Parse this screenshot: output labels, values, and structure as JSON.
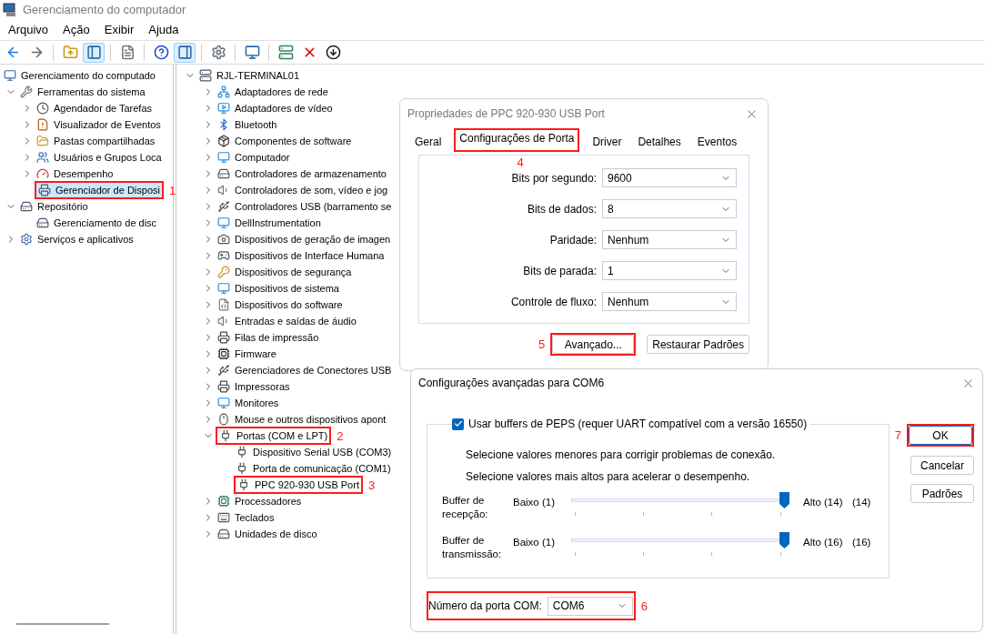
{
  "window": {
    "title": "Gerenciamento do computador"
  },
  "menu": [
    "Arquivo",
    "Ação",
    "Exibir",
    "Ajuda"
  ],
  "toolbar": {
    "groups": [
      [
        {
          "pressed": false
        },
        {
          "pressed": false
        }
      ],
      [
        {
          "pressed": false
        },
        {
          "pressed": true
        }
      ],
      [
        {
          "pressed": false
        }
      ],
      [
        {
          "pressed": false
        },
        {
          "pressed": true
        }
      ],
      [
        {
          "pressed": false
        }
      ],
      [
        {
          "pressed": false
        }
      ],
      [
        {
          "pressed": false
        },
        {
          "pressed": false
        },
        {
          "pressed": false
        }
      ]
    ]
  },
  "left_tree": {
    "label": "Gerenciamento do computado",
    "selected": false,
    "children": [
      {
        "label": "Ferramentas do sistema",
        "expanded": true,
        "selected": false,
        "children": [
          {
            "label": "Agendador de Tarefas",
            "expanded": false,
            "selected": false
          },
          {
            "label": "Visualizador de Eventos",
            "expanded": false,
            "selected": false
          },
          {
            "label": "Pastas compartilhadas",
            "expanded": false,
            "selected": false
          },
          {
            "label": "Usuários e Grupos Loca",
            "expanded": false,
            "selected": false
          },
          {
            "label": "Desempenho",
            "expanded": false,
            "selected": false
          },
          {
            "label": "Gerenciador de Disposi",
            "selected": true,
            "marker": "1"
          }
        ]
      },
      {
        "label": "Repositório",
        "expanded": true,
        "selected": false,
        "children": [
          {
            "label": "Gerenciamento de disc",
            "selected": false
          }
        ]
      },
      {
        "label": "Serviços e aplicativos",
        "expanded": false,
        "selected": false
      }
    ]
  },
  "device_tree": {
    "label": "RJL-TERMINAL01",
    "expanded": true,
    "children": [
      {
        "label": "Adaptadores de rede",
        "expanded": false
      },
      {
        "label": "Adaptadores de vídeo",
        "expanded": false
      },
      {
        "label": "Bluetooth",
        "expanded": false
      },
      {
        "label": "Componentes de software",
        "expanded": false
      },
      {
        "label": "Computador",
        "expanded": false
      },
      {
        "label": "Controladores de armazenamento",
        "expanded": false
      },
      {
        "label": "Controladores de som, vídeo e jog",
        "expanded": false
      },
      {
        "label": "Controladores USB (barramento se",
        "expanded": false
      },
      {
        "label": "DellInstrumentation",
        "expanded": false
      },
      {
        "label": "Dispositivos de geração de imagen",
        "expanded": false
      },
      {
        "label": "Dispositivos de Interface Humana",
        "expanded": false
      },
      {
        "label": "Dispositivos de segurança",
        "expanded": false
      },
      {
        "label": "Dispositivos de sistema",
        "expanded": false
      },
      {
        "label": "Dispositivos do software",
        "expanded": false
      },
      {
        "label": "Entradas e saídas de áudio",
        "expanded": false
      },
      {
        "label": "Filas de impressão",
        "expanded": false
      },
      {
        "label": "Firmware",
        "expanded": false
      },
      {
        "label": "Gerenciadores de Conectores USB",
        "expanded": false
      },
      {
        "label": "Impressoras",
        "expanded": false
      },
      {
        "label": "Monitores",
        "expanded": false
      },
      {
        "label": "Mouse e outros dispositivos apont",
        "expanded": false
      },
      {
        "label": "Portas (COM e LPT)",
        "expanded": true,
        "marker": "2",
        "children": [
          {
            "label": "Dispositivo Serial USB (COM3)"
          },
          {
            "label": "Porta de comunicação (COM1)"
          },
          {
            "label": "PPC 920-930 USB Port",
            "marker": "3"
          }
        ]
      },
      {
        "label": "Processadores",
        "expanded": false
      },
      {
        "label": "Teclados",
        "expanded": false
      },
      {
        "label": "Unidades de disco",
        "expanded": false
      }
    ]
  },
  "properties_dialog": {
    "title": "Propriedades de PPC 920-930 USB Port",
    "tabs": [
      {
        "label": "Geral",
        "selected": false
      },
      {
        "label": "Configurações de Porta",
        "selected": true,
        "marker": "4"
      },
      {
        "label": "Driver",
        "selected": false
      },
      {
        "label": "Detalhes",
        "selected": false
      },
      {
        "label": "Eventos",
        "selected": false
      }
    ],
    "settings": [
      {
        "label": "Bits por segundo:",
        "value": "9600"
      },
      {
        "label": "Bits de dados:",
        "value": "8"
      },
      {
        "label": "Paridade:",
        "value": "Nenhum"
      },
      {
        "label": "Bits de parada:",
        "value": "1"
      },
      {
        "label": "Controle de fluxo:",
        "value": "Nenhum"
      }
    ],
    "buttons": [
      {
        "label": "Avançado...",
        "marker": "5"
      },
      {
        "label": "Restaurar Padrões"
      }
    ]
  },
  "advanced_dialog": {
    "title": "Configurações avançadas para COM6",
    "fifo": {
      "label": "Usar buffers de PEPS (requer UART compatível com a versão 16550)",
      "checked": true
    },
    "hints": [
      "Selecione valores menores para corrigir problemas de conexão.",
      "Selecione valores mais altos para acelerar o desempenho."
    ],
    "buffers": [
      {
        "label": "Buffer de recepção:",
        "low": "Baixo (1)",
        "high": "Alto (14)",
        "reading": "(14)",
        "level": 1
      },
      {
        "label": "Buffer de transmissão:",
        "low": "Baixo (1)",
        "high": "Alto (16)",
        "reading": "(16)",
        "level": 1
      }
    ],
    "com_port": {
      "label": "Número da porta COM:",
      "value": "COM6",
      "marker": "6"
    },
    "buttons": [
      {
        "label": "OK",
        "marker": "7"
      },
      {
        "label": "Cancelar"
      },
      {
        "label": "Padrões"
      }
    ]
  }
}
